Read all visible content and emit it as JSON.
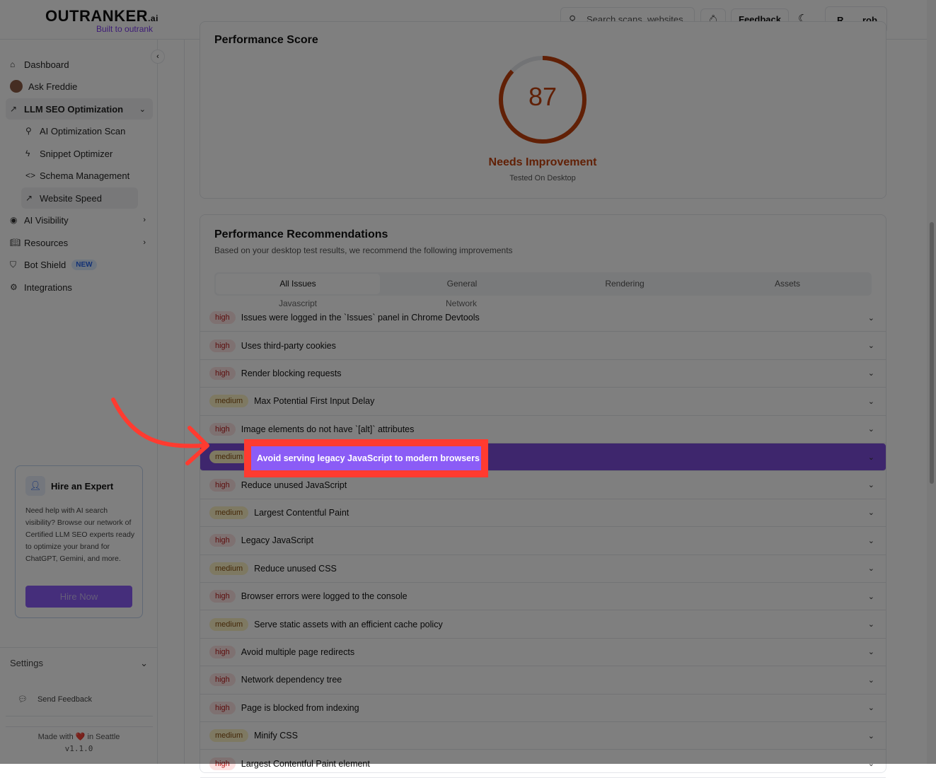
{
  "header": {
    "logo": "OUTRANKER",
    "logo_suffix": ".ai",
    "tagline": "Built to outrank",
    "search_placeholder": "Search scans, websites,",
    "feedback": "Feedback",
    "user_initial": "R",
    "user_name": "rob"
  },
  "sidebar": {
    "items": [
      {
        "label": "Dashboard",
        "icon": "home-icon"
      },
      {
        "label": "Ask Freddie",
        "icon": "avatar"
      },
      {
        "label": "LLM SEO Optimization",
        "icon": "trend-icon"
      },
      {
        "label": "AI Optimization Scan",
        "icon": "search-icon"
      },
      {
        "label": "Snippet Optimizer",
        "icon": "bolt-icon"
      },
      {
        "label": "Schema Management",
        "icon": "code-icon"
      },
      {
        "label": "Website Speed",
        "icon": "trend-icon"
      },
      {
        "label": "AI Visibility",
        "icon": "eye-icon"
      },
      {
        "label": "Resources",
        "icon": "book-icon"
      },
      {
        "label": "Bot Shield",
        "icon": "shield-icon"
      },
      {
        "label": "Integrations",
        "icon": "gear-icon"
      }
    ],
    "new_badge": "NEW",
    "hire": {
      "title": "Hire an Expert",
      "desc": "Need help with AI search visibility? Browse our network of Certified LLM SEO experts ready to optimize your brand for ChatGPT, Gemini, and more.",
      "button": "Hire Now"
    },
    "settings": "Settings",
    "send_feedback": "Send Feedback",
    "made_with": "Made with ❤️ in Seattle",
    "version": "v1.1.0"
  },
  "performance": {
    "title": "Performance Score",
    "score": "87",
    "score_value": 87,
    "status": "Needs Improvement",
    "tested": "Tested On Desktop",
    "color": "#c2410c"
  },
  "recommendations": {
    "title": "Performance Recommendations",
    "subtitle": "Based on your desktop test results, we recommend the following improvements",
    "tabs": [
      "All Issues",
      "General",
      "Rendering",
      "Assets",
      "Javascript",
      "Network"
    ],
    "items": [
      {
        "sev": "high",
        "label": "Issues were logged in the `Issues` panel in Chrome Devtools"
      },
      {
        "sev": "high",
        "label": "Uses third-party cookies"
      },
      {
        "sev": "high",
        "label": "Render blocking requests"
      },
      {
        "sev": "medium",
        "label": "Max Potential First Input Delay"
      },
      {
        "sev": "high",
        "label": "Image elements do not have `[alt]` attributes"
      },
      {
        "sev": "medium",
        "label": "Avoid serving legacy JavaScript to modern browsers"
      },
      {
        "sev": "high",
        "label": "Reduce unused JavaScript"
      },
      {
        "sev": "medium",
        "label": "Largest Contentful Paint"
      },
      {
        "sev": "high",
        "label": "Legacy JavaScript"
      },
      {
        "sev": "medium",
        "label": "Reduce unused CSS"
      },
      {
        "sev": "high",
        "label": "Browser errors were logged to the console"
      },
      {
        "sev": "medium",
        "label": "Serve static assets with an efficient cache policy"
      },
      {
        "sev": "high",
        "label": "Avoid multiple page redirects"
      },
      {
        "sev": "high",
        "label": "Network dependency tree"
      },
      {
        "sev": "high",
        "label": "Page is blocked from indexing"
      },
      {
        "sev": "medium",
        "label": "Minify CSS"
      },
      {
        "sev": "high",
        "label": "Largest Contentful Paint element"
      }
    ]
  },
  "callout": {
    "label": "Avoid serving legacy JavaScript to modern browsers"
  }
}
